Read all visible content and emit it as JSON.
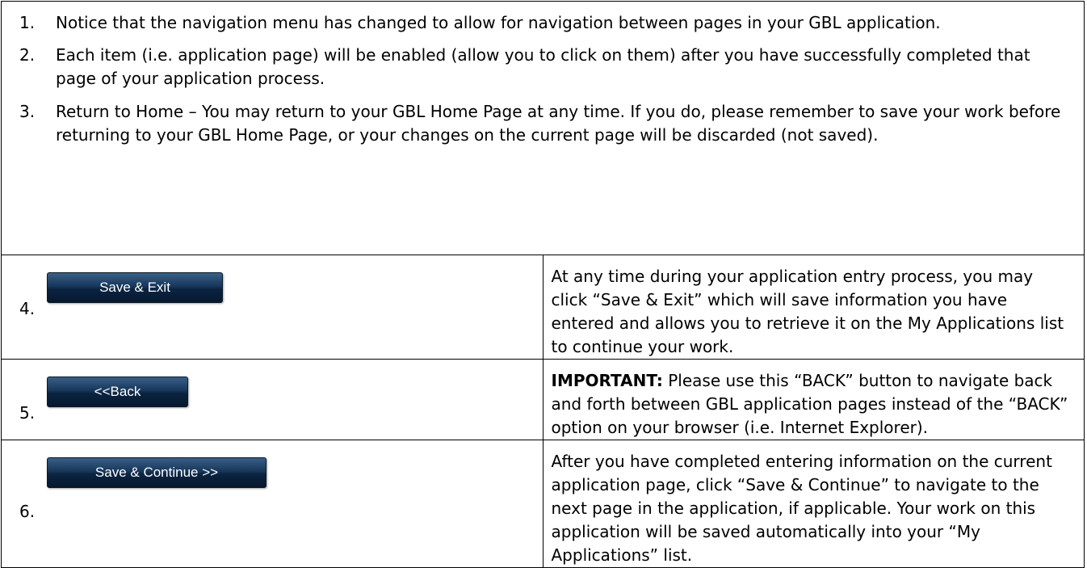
{
  "list": [
    {
      "num": "1.",
      "text": "Notice that the navigation menu has changed to allow for navigation between pages in your GBL application."
    },
    {
      "num": "2.",
      "text": "Each item (i.e. application page) will be enabled (allow you to click on them) after you have successfully completed that page of your application process."
    },
    {
      "num": "3.",
      "text": "Return to Home – You may return to your GBL Home Page at any time.  If you do, please remember to save your work before returning to your GBL Home Page, or your changes on the current page will be discarded (not saved)."
    }
  ],
  "rows": [
    {
      "num": "4.",
      "button": "Save & Exit",
      "text": "At any time during your application entry process, you may click “Save & Exit” which will save information you have entered and allows you to retrieve it on the My Applications list to continue your work."
    },
    {
      "num": "5.",
      "button": "<<Back",
      "bold": "IMPORTANT:",
      "text": "  Please use this “BACK” button to navigate back and forth between GBL application pages instead of the “BACK” option on your browser (i.e. Internet Explorer)."
    },
    {
      "num": "6.",
      "button": "Save & Continue >>",
      "text": "After you have completed entering information on the current application page, click “Save & Continue” to navigate to the next page in the application, if applicable.  Your work on this application will be saved automatically into your “My Applications” list."
    }
  ]
}
